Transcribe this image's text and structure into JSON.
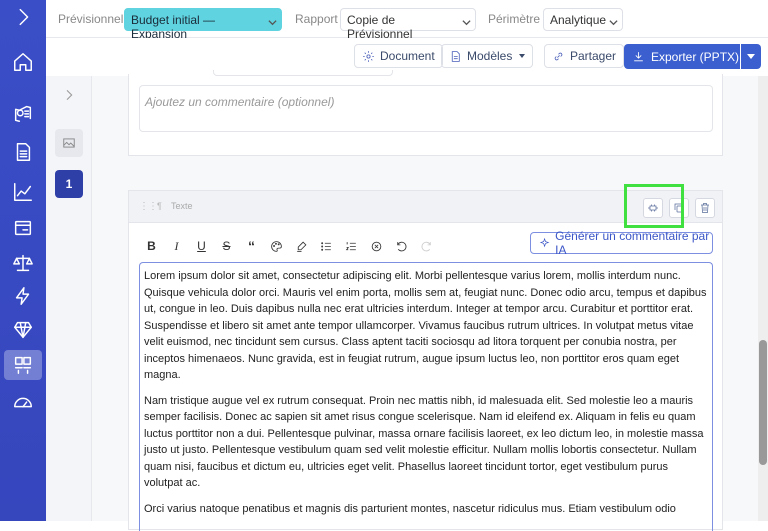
{
  "topbar": {
    "previsionnel_label": "Prévisionnel",
    "previsionnel_value": "Budget initial — Expansion",
    "rapport_label": "Rapport",
    "rapport_value": "Copie de Prévisionnel",
    "perimetre_label": "Périmètre",
    "perimetre_value": "Analytique"
  },
  "toolbar": {
    "document": "Document",
    "modeles": "Modèles",
    "partager": "Partager",
    "exporter": "Exporter (PPTX)"
  },
  "leftpanel": {
    "page_number": "1"
  },
  "comment_placeholder": "Ajoutez un commentaire (optionnel)",
  "block": {
    "type_label": "Texte",
    "ai_button": "Générer un commentaire par IA",
    "paragraphs": [
      "Lorem ipsum dolor sit amet, consectetur adipiscing elit. Morbi pellentesque varius lorem, mollis interdum nunc. Quisque vehicula dolor orci. Mauris vel enim porta, mollis sem at, feugiat nunc. Donec odio arcu, tempus et dapibus ut, congue in leo. Duis dapibus nulla nec erat ultricies interdum. Integer at tempor arcu. Curabitur et porttitor erat. Suspendisse et libero sit amet ante tempor ullamcorper. Vivamus faucibus rutrum ultrices. In volutpat metus vitae velit euismod, nec tincidunt sem cursus. Class aptent taciti sociosqu ad litora torquent per conubia nostra, per inceptos himenaeos. Nunc gravida, est in feugiat rutrum, augue ipsum luctus leo, non porttitor eros quam eget magna.",
      "Nam tristique augue vel ex rutrum consequat. Proin nec mattis nibh, id malesuada elit. Sed molestie leo a mauris semper facilisis. Donec ac sapien sit amet risus congue scelerisque. Nam id eleifend ex. Aliquam in felis eu quam luctus porttitor non a dui. Pellentesque pulvinar, massa ornare facilisis laoreet, ex leo dictum leo, in molestie massa justo ut justo. Pellentesque vestibulum quam sed velit molestie efficitur. Nullam mollis lobortis consectetur. Nullam quam nisi, faucibus et dictum eu, ultricies eget velit. Phasellus laoreet tincidunt tortor, eget vestibulum purus volutpat ac.",
      "Orci varius natoque penatibus et magnis dis parturient montes, nascetur ridiculus mus. Etiam vestibulum odio"
    ]
  },
  "colors": {
    "sidebar": "#3a4ec7",
    "accent": "#3b5fcf",
    "selected": "#5fd3df",
    "highlight": "#3fe03f"
  }
}
